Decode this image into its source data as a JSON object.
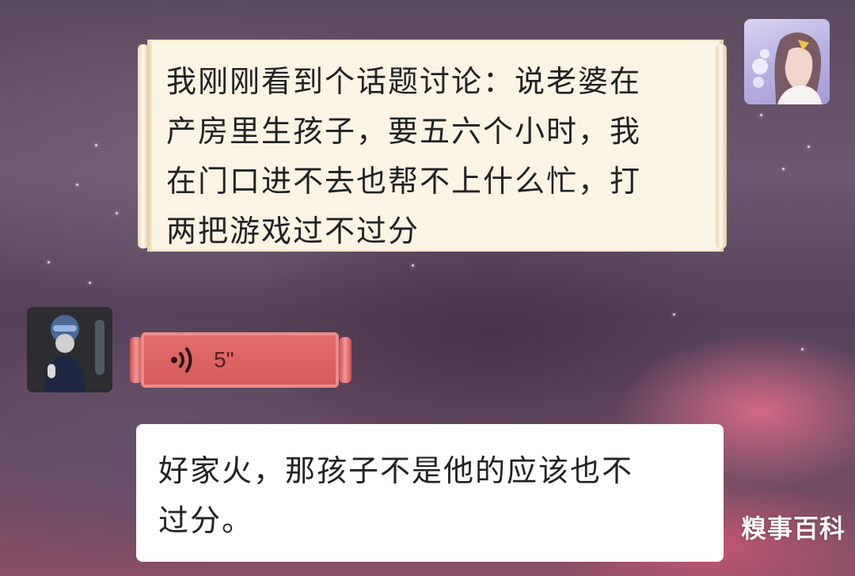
{
  "chat": {
    "messages": [
      {
        "sender": "right",
        "text": "我刚刚看到个话题讨论：说老婆在\n产房里生孩子，要五六个小时，我\n在门口进不去也帮不上什么忙，打\n两把游戏过不过分"
      },
      {
        "sender": "left",
        "type": "voice",
        "icon": "voice-wave-icon",
        "duration": "5\""
      },
      {
        "sender": "left",
        "text": "好家火，那孩子不是他的应该也不\n过分。"
      }
    ]
  },
  "watermark": {
    "text": "糗事百科"
  },
  "colors": {
    "scroll_fill": "#fbf3e3",
    "voice_fill": "#d65b5b",
    "bubble_white": "#ffffff",
    "accent_pink": "#e66e8c"
  }
}
